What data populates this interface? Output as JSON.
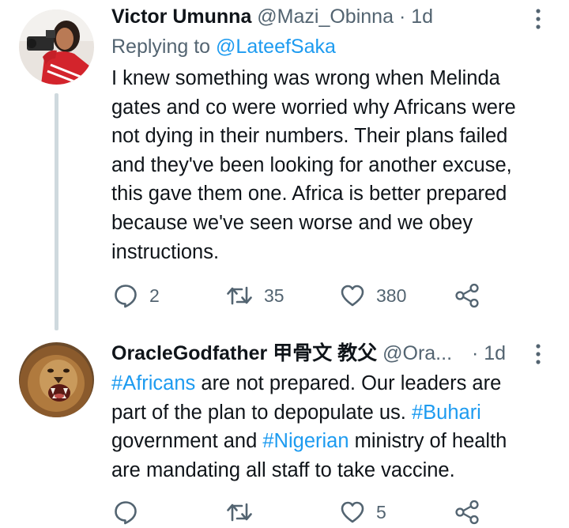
{
  "tweets": [
    {
      "name": "Victor Umunna",
      "handle": "@Mazi_Obinna",
      "separator": "·",
      "time": "1d",
      "replying_prefix": "Replying to",
      "replying_to": "@LateefSaka",
      "text_lines": [
        "I knew something was wrong when Melinda",
        "gates and co were worried why Africans were",
        "not dying in their numbers. Their plans failed",
        "and they've been looking for another excuse,",
        "this gave them one. Africa is better prepared",
        "because we've seen worse and we obey",
        "instructions."
      ],
      "reply_count": "2",
      "retweet_count": "35",
      "like_count": "380"
    },
    {
      "name": "OracleGodfather 甲骨文 教父",
      "handle": "@Ora...",
      "separator": "·",
      "time": "1d",
      "text": {
        "line1_tag": "#Africans",
        "line1_rest": " are not prepared. Our leaders are",
        "line2_pre": "part of the plan to depopulate us. ",
        "line2_tag": "#Buhari",
        "line3_tag": "#Nigerian",
        "line3_pre": "government and ",
        "line3_rest": " ministry of health",
        "line4": "are mandating all staff to take vaccine."
      },
      "reply_count": "",
      "retweet_count": "",
      "like_count": "5"
    }
  ],
  "colors": {
    "accent": "#1d9bf0",
    "secondary_text": "#536471",
    "primary_text": "#0f1419",
    "thread_line": "#cfd9de"
  },
  "icons": {
    "reply": "speech-bubble-icon",
    "retweet": "retweet-arrows-icon",
    "like": "heart-outline-icon",
    "share": "share-nodes-icon",
    "more": "vertical-ellipsis-icon"
  }
}
